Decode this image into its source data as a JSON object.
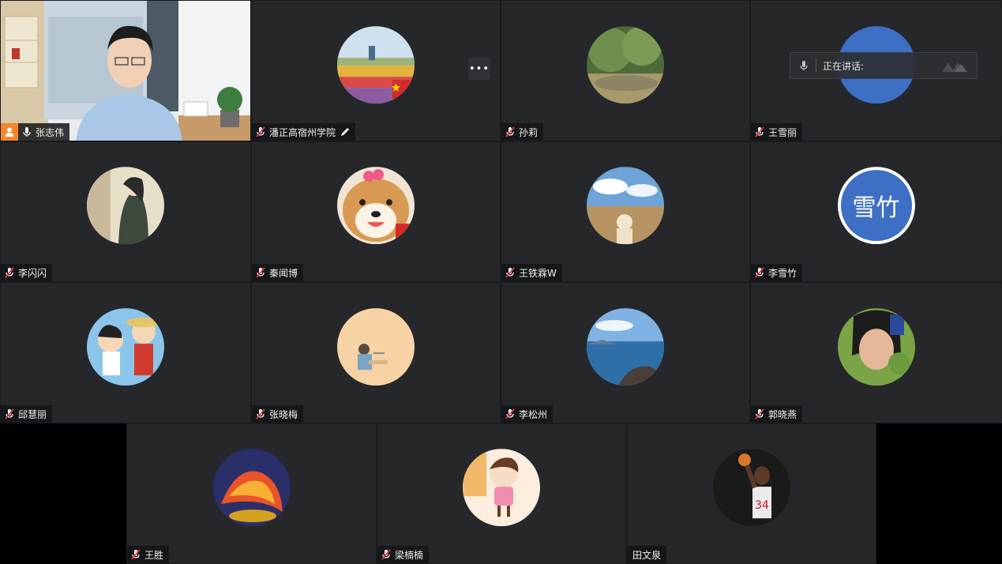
{
  "speaking": {
    "label": "正在讲话:"
  },
  "host": {
    "name": "张志伟"
  },
  "participants": [
    {
      "name": "潘正高宿州学院",
      "avatar": "flower-field-avatar"
    },
    {
      "name": "孙莉",
      "avatar": "nature-avatar"
    },
    {
      "name": "王雪丽",
      "avatar": "blue-text-avatar"
    },
    {
      "name": "李闪闪",
      "avatar": "anime-girl-avatar"
    },
    {
      "name": "秦闻博",
      "avatar": "shiba-dog-avatar"
    },
    {
      "name": "王铁霖W",
      "avatar": "reeds-avatar"
    },
    {
      "name": "李雪竹",
      "avatar_text": "雪竹"
    },
    {
      "name": "邱慧丽",
      "avatar": "cartoon-boys-avatar"
    },
    {
      "name": "张晓梅",
      "avatar": "illustration-avatar"
    },
    {
      "name": "李松州",
      "avatar": "sea-avatar"
    },
    {
      "name": "郭晓燕",
      "avatar": "girl-photo-avatar"
    },
    {
      "name": "王胜",
      "avatar": "phoenix-avatar"
    },
    {
      "name": "梁楠楠",
      "avatar": "cartoon-girl-avatar"
    },
    {
      "name": "田文泉",
      "avatar": "basketball-avatar"
    }
  ],
  "colors": {
    "tile": "#25272b",
    "host_badge": "#f5862b",
    "text_avatar": "#3d6fc4"
  }
}
